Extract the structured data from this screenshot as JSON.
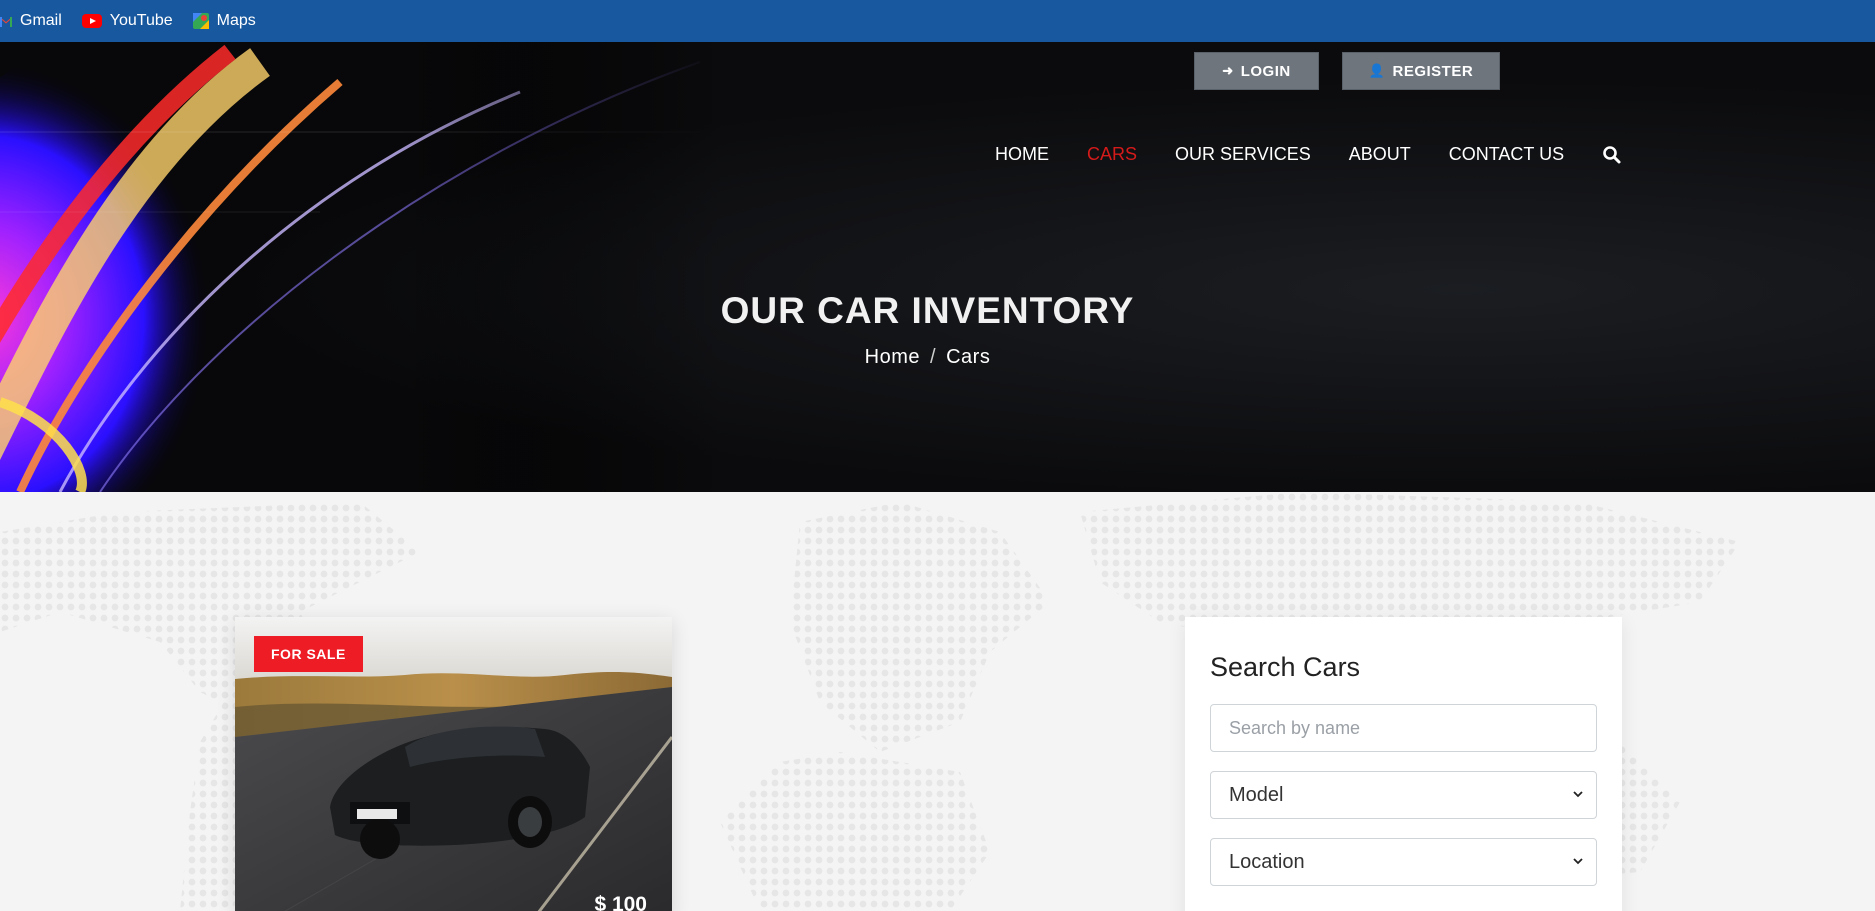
{
  "bookmarks": [
    {
      "label": "Gmail",
      "icon": "gmail-icon"
    },
    {
      "label": "YouTube",
      "icon": "youtube-icon"
    },
    {
      "label": "Maps",
      "icon": "maps-icon"
    }
  ],
  "auth": {
    "login_label": "LOGIN",
    "register_label": "REGISTER"
  },
  "nav": {
    "items": [
      {
        "label": "HOME",
        "active": false
      },
      {
        "label": "CARS",
        "active": true
      },
      {
        "label": "OUR SERVICES",
        "active": false
      },
      {
        "label": "ABOUT",
        "active": false
      },
      {
        "label": "CONTACT US",
        "active": false
      }
    ],
    "search_icon": "search-icon"
  },
  "hero": {
    "title": "OUR CAR INVENTORY",
    "breadcrumb": {
      "home": "Home",
      "separator": "/",
      "current": "Cars"
    }
  },
  "listing": {
    "badge": "FOR SALE",
    "price": "$ 100"
  },
  "search_panel": {
    "title": "Search Cars",
    "name_placeholder": "Search by name",
    "model_select": "Model",
    "location_select": "Location"
  },
  "colors": {
    "bookmarks_bar": "#17589f",
    "accent_red": "#d51a1a",
    "badge_red": "#ee1c25",
    "button_gray": "#6e757d"
  }
}
